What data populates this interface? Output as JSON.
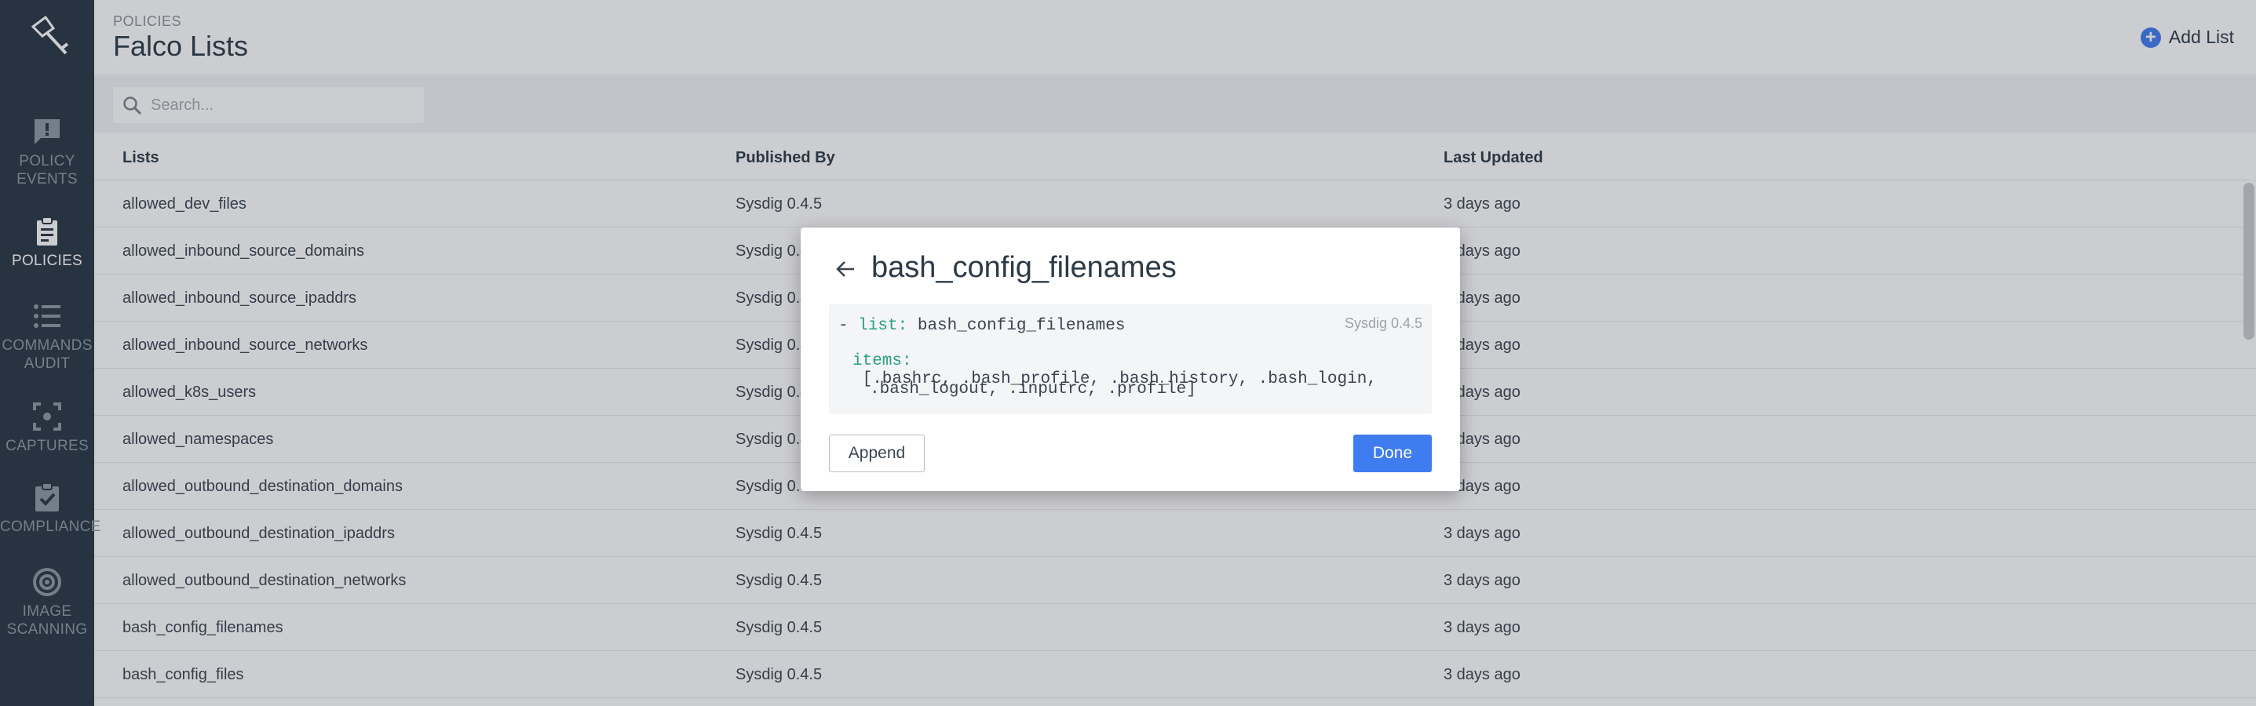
{
  "sidebar": {
    "items": [
      {
        "icon": "policy-events-icon",
        "line1": "POLICY",
        "line2": "EVENTS"
      },
      {
        "icon": "policies-icon",
        "line1": "POLICIES",
        "line2": ""
      },
      {
        "icon": "commands-audit-icon",
        "line1": "COMMANDS",
        "line2": "AUDIT"
      },
      {
        "icon": "captures-icon",
        "line1": "CAPTURES",
        "line2": ""
      },
      {
        "icon": "compliance-icon",
        "line1": "COMPLIANCE",
        "line2": ""
      },
      {
        "icon": "image-scanning-icon",
        "line1": "IMAGE",
        "line2": "SCANNING"
      }
    ],
    "active": "POLICIES"
  },
  "header": {
    "breadcrumb": "POLICIES",
    "title": "Falco Lists",
    "add_label": "Add List"
  },
  "search": {
    "placeholder": "Search..."
  },
  "table": {
    "columns": [
      "Lists",
      "Published By",
      "Last Updated"
    ],
    "rows": [
      [
        "allowed_dev_files",
        "Sysdig 0.4.5",
        "3 days ago"
      ],
      [
        "allowed_inbound_source_domains",
        "Sysdig 0.4.5",
        "3 days ago"
      ],
      [
        "allowed_inbound_source_ipaddrs",
        "Sysdig 0.4.5",
        "3 days ago"
      ],
      [
        "allowed_inbound_source_networks",
        "Sysdig 0.4.5",
        "3 days ago"
      ],
      [
        "allowed_k8s_users",
        "Sysdig 0.4.5",
        "3 days ago"
      ],
      [
        "allowed_namespaces",
        "Sysdig 0.4.5",
        "3 days ago"
      ],
      [
        "allowed_outbound_destination_domains",
        "Sysdig 0.4.5",
        "3 days ago"
      ],
      [
        "allowed_outbound_destination_ipaddrs",
        "Sysdig 0.4.5",
        "3 days ago"
      ],
      [
        "allowed_outbound_destination_networks",
        "Sysdig 0.4.5",
        "3 days ago"
      ],
      [
        "bash_config_filenames",
        "Sysdig 0.4.5",
        "3 days ago"
      ],
      [
        "bash_config_files",
        "Sysdig 0.4.5",
        "3 days ago"
      ]
    ]
  },
  "modal": {
    "title": "bash_config_filenames",
    "published_by": "Sysdig 0.4.5",
    "code": {
      "dash": "- ",
      "list_key": "list:",
      "list_value": " bash_config_filenames",
      "items_key": "items:",
      "items_line1": " [.bashrc, .bash_profile, .bash_history, .bash_login,",
      "items_line2": ".bash_logout, .inputrc, .profile]"
    },
    "append_label": "Append",
    "done_label": "Done"
  },
  "colors": {
    "sidebar": "#283543",
    "accent": "#3f7cf0",
    "yaml_key": "#2aa17a"
  }
}
